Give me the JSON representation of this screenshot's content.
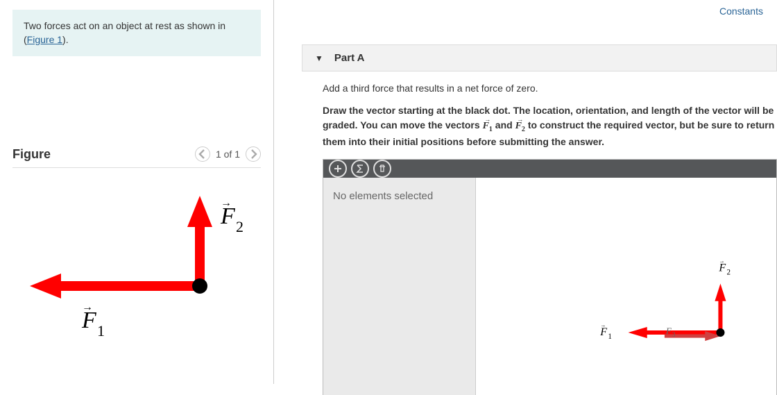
{
  "problem": {
    "text_before_link": "Two forces act on an object at rest as shown in (",
    "figure_link": "Figure 1",
    "text_after_link": ")."
  },
  "figure": {
    "title": "Figure",
    "pager": "1 of 1",
    "f1_label": "F",
    "f1_sub": "1",
    "f2_label": "F",
    "f2_sub": "2"
  },
  "constants_label": "Constants",
  "part": {
    "label": "Part A",
    "prompt": "Add a third force that results in a net force of zero.",
    "instructions_before_f1": "Draw the vector starting at the black dot. The location, orientation, and length of the vector will be graded. You can move the vectors ",
    "f1": "F",
    "f1_sub": "1",
    "instructions_mid": " and ",
    "f2": "F",
    "f2_sub": "2",
    "instructions_after": " to construct the required vector, but be sure to return them into their initial positions before submitting the answer."
  },
  "drawing": {
    "inspector_text": "No elements selected",
    "canvas": {
      "f1_label": "F",
      "f1_sub": "1",
      "f2_label": "F",
      "f2_sub": "2",
      "f3_label": "F",
      "f3_sub": "3"
    }
  }
}
